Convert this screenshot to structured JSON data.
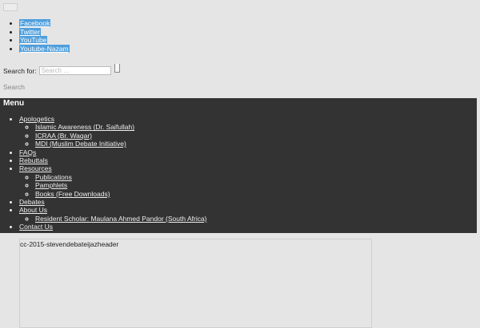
{
  "social": [
    {
      "label": "Facebook"
    },
    {
      "label": "Twitter"
    },
    {
      "label": "YouTube"
    },
    {
      "label": "Youtube-Nazam"
    }
  ],
  "search": {
    "label": "Search for:",
    "placeholder": "Search …",
    "submit_label": "Search"
  },
  "menu": {
    "title": "Menu",
    "items": [
      {
        "label": "Apologetics",
        "children": [
          {
            "label": "Islamic Awareness (Dr. Saifullah)"
          },
          {
            "label": "ICRAA (Br. Waqar)"
          },
          {
            "label": "MDI (Muslim Debate Initiative)"
          }
        ]
      },
      {
        "label": "FAQs"
      },
      {
        "label": "Rebuttals"
      },
      {
        "label": "Resources",
        "children": [
          {
            "label": "Publications"
          },
          {
            "label": "Pamphlets"
          },
          {
            "label": "Books (Free Downloads)"
          }
        ]
      },
      {
        "label": "Debates"
      },
      {
        "label": "About Us",
        "children": [
          {
            "label": "Resident Scholar: Maulana Ahmed Pandor (South Africa)"
          }
        ]
      },
      {
        "label": "Contact Us"
      }
    ]
  },
  "header_image": {
    "alt_text": "cc-2015-stevendebateijazheader"
  }
}
